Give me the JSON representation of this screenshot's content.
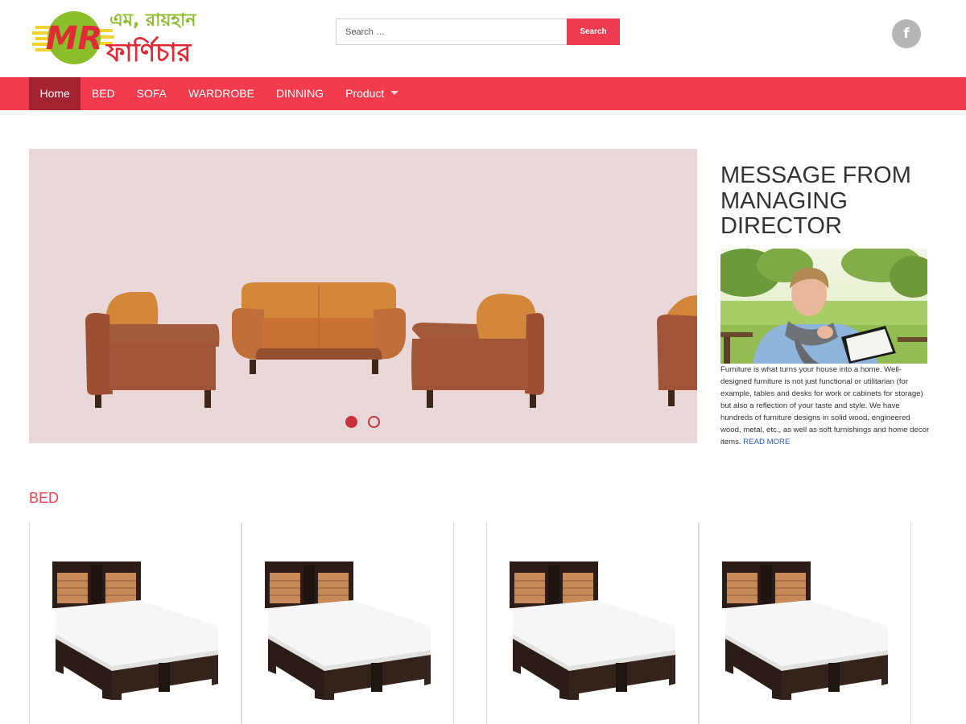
{
  "brand": {
    "logo_letters": "MR",
    "name_line1": "এম, রায়হান",
    "name_line2": "ফার্ণিচার",
    "colors": {
      "red": "#e02a35",
      "green": "#8cbd2b",
      "yellow": "#f2d230"
    }
  },
  "search": {
    "placeholder": "Search …",
    "button_label": "Search",
    "icon": "search-icon"
  },
  "social": {
    "facebook_glyph": "f",
    "icon": "facebook-icon"
  },
  "nav": {
    "items": [
      {
        "label": "Home",
        "active": true
      },
      {
        "label": "BED"
      },
      {
        "label": "SOFA"
      },
      {
        "label": "WARDROBE"
      },
      {
        "label": "DINNING"
      },
      {
        "label": "Product",
        "dropdown": true
      }
    ]
  },
  "slider": {
    "slide_count": 2,
    "active_slide": 1
  },
  "message": {
    "title": "MESSAGE FROM MANAGING DIRECTOR",
    "body": "Furniture is what turns your house into a home. Well-designed furniture is not just functional or utilitarian (for example, tables and desks for work or cabinets for storage) but also a reflection of your taste and style. We have hundreds of furniture designs in solid wood, engineered wood, metal, etc., as well as soft furnishings and home decor items.",
    "read_more": "READ MORE"
  },
  "bed_section": {
    "title": "BED",
    "products": [
      {
        "image": "bed-image"
      },
      {
        "image": "bed-image"
      },
      {
        "image": "bed-image"
      },
      {
        "image": "bed-image"
      }
    ]
  },
  "theme": {
    "primary": "#f23c4e",
    "nav_active": "#a3222f",
    "link": "#2a56c6"
  }
}
